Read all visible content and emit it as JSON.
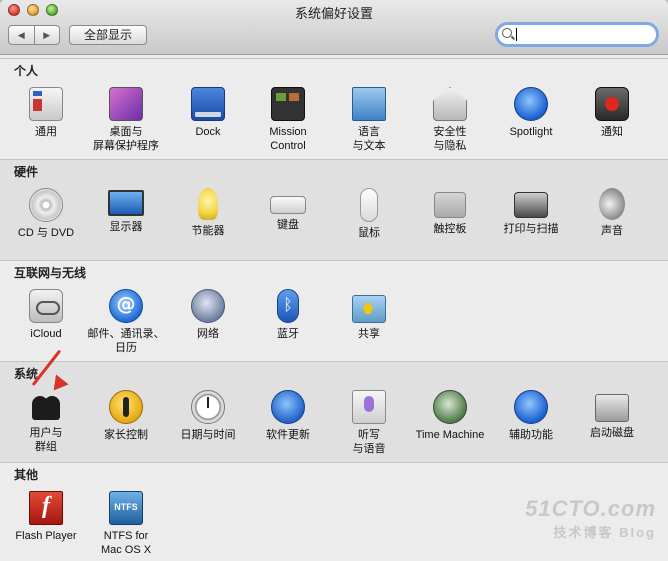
{
  "window": {
    "title": "系统偏好设置",
    "show_all": "全部显示",
    "nav_back": "◀",
    "nav_forward": "▶",
    "search": {
      "value": "",
      "placeholder": ""
    }
  },
  "sections": {
    "personal": {
      "title": "个人",
      "items": [
        {
          "label": "通用"
        },
        {
          "label": "桌面与\n屏幕保护程序"
        },
        {
          "label": "Dock"
        },
        {
          "label": "Mission\nControl"
        },
        {
          "label": "语言\n与文本"
        },
        {
          "label": "安全性\n与隐私"
        },
        {
          "label": "Spotlight"
        },
        {
          "label": "通知"
        }
      ]
    },
    "hardware": {
      "title": "硬件",
      "items": [
        {
          "label": "CD 与 DVD"
        },
        {
          "label": "显示器"
        },
        {
          "label": "节能器"
        },
        {
          "label": "键盘"
        },
        {
          "label": "鼠标"
        },
        {
          "label": "触控板"
        },
        {
          "label": "打印与扫描"
        },
        {
          "label": "声音"
        }
      ]
    },
    "internet": {
      "title": "互联网与无线",
      "items": [
        {
          "label": "iCloud"
        },
        {
          "label": "邮件、通讯录、\n日历"
        },
        {
          "label": "网络"
        },
        {
          "label": "蓝牙"
        },
        {
          "label": "共享"
        }
      ]
    },
    "system": {
      "title": "系统",
      "items": [
        {
          "label": "用户与\n群组"
        },
        {
          "label": "家长控制"
        },
        {
          "label": "日期与时间"
        },
        {
          "label": "软件更新"
        },
        {
          "label": "听写\n与语音"
        },
        {
          "label": "Time Machine"
        },
        {
          "label": "辅助功能"
        },
        {
          "label": "启动磁盘"
        }
      ]
    },
    "other": {
      "title": "其他",
      "items": [
        {
          "label": "Flash Player"
        },
        {
          "label": "NTFS for\nMac OS X"
        }
      ]
    }
  },
  "watermark": {
    "line1": "51CTO.com",
    "line2": "技术博客  Blog"
  },
  "colors": {
    "annotation_arrow": "#d7332a",
    "search_focus": "#7fa9e6"
  }
}
